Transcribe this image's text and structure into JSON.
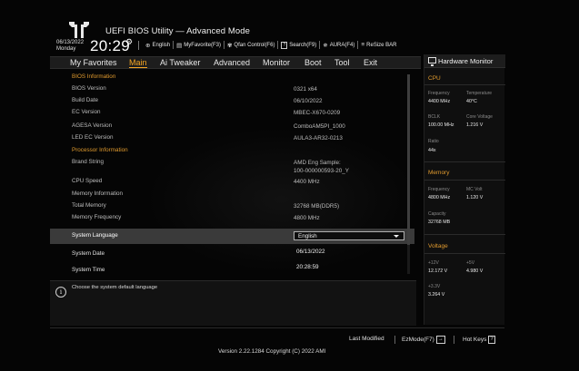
{
  "header": {
    "title": "UEFI BIOS Utility — Advanced Mode",
    "date": "06/13/2022",
    "day": "Monday",
    "time": "20:29",
    "toolbar": [
      {
        "icon": "globe-icon",
        "glyph": "⊕",
        "label": "English"
      },
      {
        "icon": "favorite-icon",
        "glyph": "▤",
        "label": "MyFavorite(F3)"
      },
      {
        "icon": "fan-icon",
        "glyph": "✾",
        "label": "Qfan Control(F6)"
      },
      {
        "icon": "search-icon",
        "glyph": "?",
        "label": "Search(F9)"
      },
      {
        "icon": "aura-icon",
        "glyph": "✵",
        "label": "AURA(F4)"
      },
      {
        "icon": "resize-bar-icon",
        "glyph": "≡",
        "label": "ReSize BAR"
      }
    ]
  },
  "menu": [
    {
      "label": "My Favorites",
      "active": false
    },
    {
      "label": "Main",
      "active": true
    },
    {
      "label": "Ai Tweaker",
      "active": false
    },
    {
      "label": "Advanced",
      "active": false
    },
    {
      "label": "Monitor",
      "active": false
    },
    {
      "label": "Boot",
      "active": false
    },
    {
      "label": "Tool",
      "active": false
    },
    {
      "label": "Exit",
      "active": false
    }
  ],
  "main": {
    "rows": [
      {
        "label": "BIOS Information",
        "value": "",
        "type": "section"
      },
      {
        "label": "BIOS Version",
        "value": "0321  x64",
        "type": "info"
      },
      {
        "label": "Build Date",
        "value": "06/10/2022",
        "type": "info"
      },
      {
        "label": "EC Version",
        "value": "MBEC-X670-0209",
        "type": "info"
      },
      {
        "label": "AGESA Version",
        "value": "ComboAM5PI_1000",
        "type": "info"
      },
      {
        "label": "LED EC Version",
        "value": "AULA3-AR32-0213",
        "type": "info"
      },
      {
        "label": "Processor Information",
        "value": "",
        "type": "section"
      },
      {
        "label": "Brand String",
        "value": "AMD Eng Sample:",
        "value2": "100-000000593-20_Y",
        "type": "info"
      },
      {
        "label": "CPU Speed",
        "value": "4400 MHz",
        "type": "info"
      },
      {
        "label": "Memory Information",
        "value": "",
        "type": "info"
      },
      {
        "label": "Total Memory",
        "value": "32768 MB(DDR5)",
        "type": "info"
      },
      {
        "label": "Memory Frequency",
        "value": "4800 MHz",
        "type": "info"
      },
      {
        "label": "System Language",
        "value": "English",
        "type": "select"
      },
      {
        "label": "System Date",
        "value": "06/13/2022",
        "type": "editable"
      },
      {
        "label": "System Time",
        "value": "20:28:59",
        "type": "editable"
      }
    ],
    "help_text": "Choose the system default language"
  },
  "hardware_monitor": {
    "title": "Hardware Monitor",
    "sections": [
      {
        "name": "CPU",
        "items": [
          {
            "key": "Frequency",
            "value": "4400 MHz"
          },
          {
            "key": "Temperature",
            "value": "40°C"
          },
          {
            "key": "BCLK",
            "value": "100.00 MHz"
          },
          {
            "key": "Core Voltage",
            "value": "1.216 V"
          },
          {
            "key": "Ratio",
            "value": "44x"
          }
        ]
      },
      {
        "name": "Memory",
        "items": [
          {
            "key": "Frequency",
            "value": "4800 MHz"
          },
          {
            "key": "MC Volt",
            "value": "1.120 V"
          },
          {
            "key": "Capacity",
            "value": "32768 MB"
          }
        ]
      },
      {
        "name": "Voltage",
        "items": [
          {
            "key": "+12V",
            "value": "12.172 V"
          },
          {
            "key": "+5V",
            "value": "4.980 V"
          },
          {
            "key": "+3.3V",
            "value": "3.264 V"
          }
        ]
      }
    ]
  },
  "footer": {
    "last_modified": "Last Modified",
    "ezmode": "EzMode(F7)",
    "ezmode_icon": "→",
    "hotkeys": "Hot Keys",
    "hotkeys_icon": "?",
    "copyright": "Version 2.22.1284 Copyright (C) 2022 AMI"
  },
  "colors": {
    "accent": "#f5a623",
    "section": "#e09a2e",
    "background": "#050505"
  }
}
